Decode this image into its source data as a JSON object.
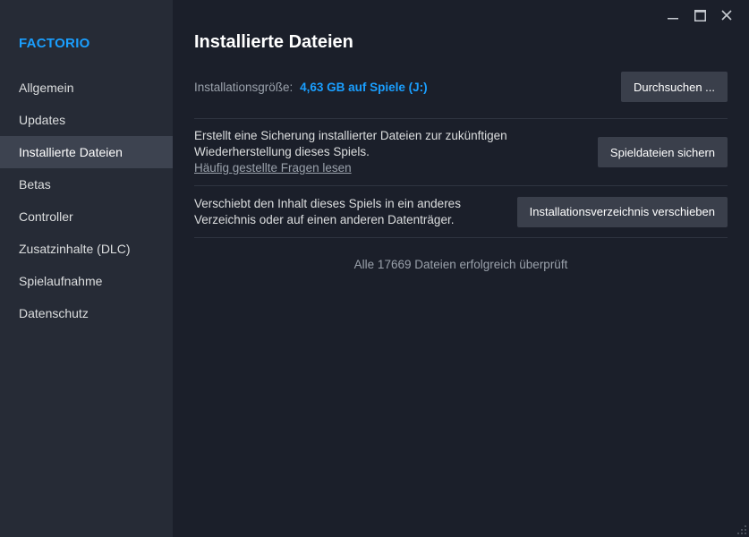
{
  "sidebar": {
    "game_title": "FACTORIO",
    "items": [
      {
        "label": "Allgemein",
        "active": false
      },
      {
        "label": "Updates",
        "active": false
      },
      {
        "label": "Installierte Dateien",
        "active": true
      },
      {
        "label": "Betas",
        "active": false
      },
      {
        "label": "Controller",
        "active": false
      },
      {
        "label": "Zusatzinhalte (DLC)",
        "active": false
      },
      {
        "label": "Spielaufnahme",
        "active": false
      },
      {
        "label": "Datenschutz",
        "active": false
      }
    ]
  },
  "window_controls": {
    "icons": [
      "minimize-icon",
      "maximize-icon",
      "close-icon"
    ]
  },
  "main": {
    "title": "Installierte Dateien",
    "install_size": {
      "label": "Installationsgröße:",
      "value": "4,63 GB auf Spiele (J:)",
      "browse_button": "Durchsuchen ..."
    },
    "backup": {
      "description_line1": "Erstellt eine Sicherung installierter Dateien zur zukünftigen",
      "description_line2": "Wiederherstellung dieses Spiels.",
      "faq_link": "Häufig gestellte Fragen lesen",
      "button": "Spieldateien sichern"
    },
    "move": {
      "description_line1": "Verschiebt den Inhalt dieses Spiels in ein anderes",
      "description_line2": "Verzeichnis oder auf einen anderen Datenträger.",
      "button": "Installationsverzeichnis verschieben"
    },
    "verified_status": "Alle 17669 Dateien erfolgreich überprüft"
  },
  "colors": {
    "accent": "#1a9fff",
    "sidebar_bg": "#262b36",
    "main_bg": "#1b1f2a",
    "active_item_bg": "#3d4350",
    "button_bg": "#3a3f4b"
  }
}
